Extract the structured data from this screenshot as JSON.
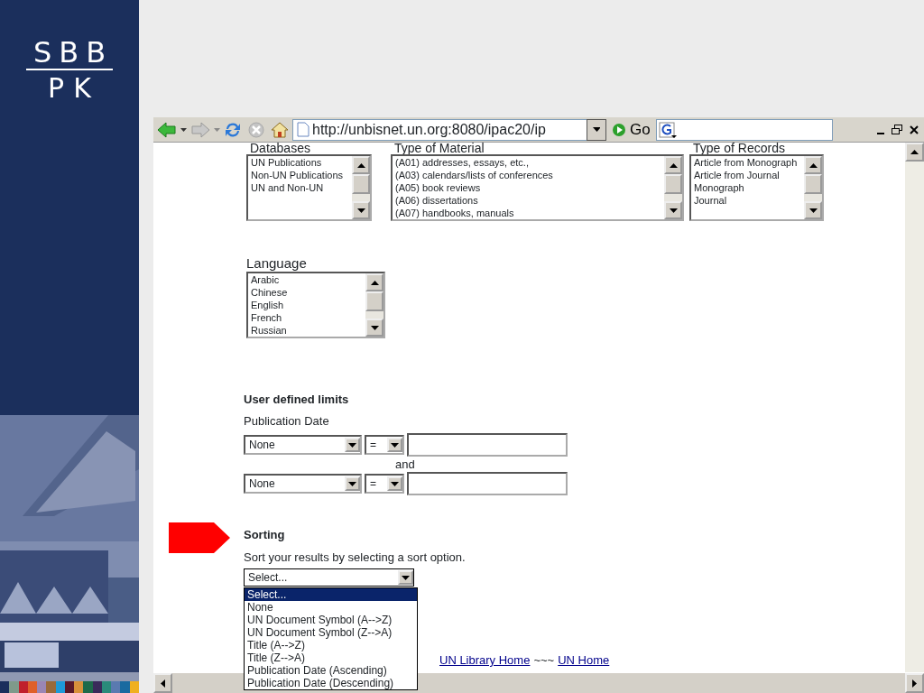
{
  "slide": {
    "logo": {
      "line1": "SBB",
      "line2": "PK"
    }
  },
  "browser": {
    "url": "http://unbisnet.un.org:8080/ipac20/ip",
    "go_label": "Go"
  },
  "filters": [
    {
      "heading": "Databases",
      "options": [
        "UN Publications",
        "Non-UN Publications",
        "UN and Non-UN"
      ]
    },
    {
      "heading": "Type of Material",
      "options": [
        "(A01) addresses, essays, etc.,",
        "(A03) calendars/lists of conferences",
        "(A05) book reviews",
        "(A06) dissertations",
        "(A07) handbooks, manuals"
      ]
    },
    {
      "heading": "Type of Records",
      "options": [
        "Article from Monograph",
        "Article from Journal",
        "Monograph",
        "Journal"
      ]
    }
  ],
  "language": {
    "label": "Language",
    "options": [
      "Arabic",
      "Chinese",
      "English",
      "French",
      "Russian"
    ]
  },
  "limits": {
    "title": "User defined limits",
    "subtitle": "Publication Date",
    "connector": "and",
    "rows": [
      {
        "field": "None",
        "operator": "="
      },
      {
        "field": "None",
        "operator": "="
      }
    ]
  },
  "sorting": {
    "title": "Sorting",
    "text": "Sort your results by selecting a sort option.",
    "value": "Select...",
    "expanded": true,
    "options": [
      {
        "label": "Select...",
        "selected": true
      },
      {
        "label": "None",
        "selected": false
      },
      {
        "label": "UN Document Symbol (A-->Z)",
        "selected": false
      },
      {
        "label": "UN Document Symbol (Z-->A)",
        "selected": false
      },
      {
        "label": "Title (A-->Z)",
        "selected": false
      },
      {
        "label": "Title (Z-->A)",
        "selected": false
      },
      {
        "label": "Publication Date (Ascending)",
        "selected": false
      },
      {
        "label": "Publication Date (Descending)",
        "selected": false
      }
    ]
  },
  "links": [
    {
      "kind": "link",
      "label": "UN Library Home"
    },
    {
      "kind": "text",
      "label": "~~~"
    },
    {
      "kind": "link",
      "label": "UN Home"
    }
  ]
}
